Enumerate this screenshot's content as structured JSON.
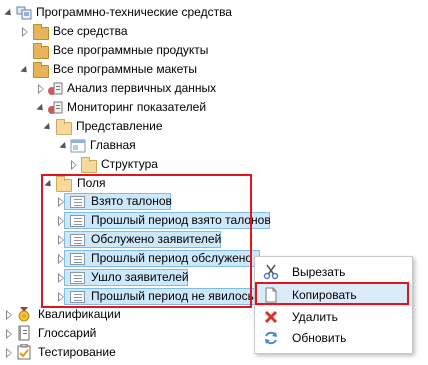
{
  "tree": {
    "root": "Программно-технические средства",
    "all_assets": "Все средства",
    "all_products": "Все программные продукты",
    "all_layouts": "Все программные макеты",
    "primary_analysis": "Анализ первичных данных",
    "monitoring": "Мониторинг показателей",
    "view": "Представление",
    "main": "Главная",
    "structure": "Структура",
    "fields": "Поля",
    "field_items": [
      "Взято талонов",
      "Прошлый период взято талонов",
      "Обслужено заявителей",
      "Прошлый период обслуженo",
      "Ушло заявителей",
      "Прошлый период не явилось"
    ],
    "qualifications": "Квалификации",
    "glossary": "Глоссарий",
    "testing": "Тестирование"
  },
  "context_menu": {
    "cut": "Вырезать",
    "copy": "Копировать",
    "delete": "Удалить",
    "refresh": "Обновить"
  },
  "colors": {
    "selection": "#cde8fb",
    "highlight_border": "#e3141b",
    "folder": "#e8b45a"
  }
}
